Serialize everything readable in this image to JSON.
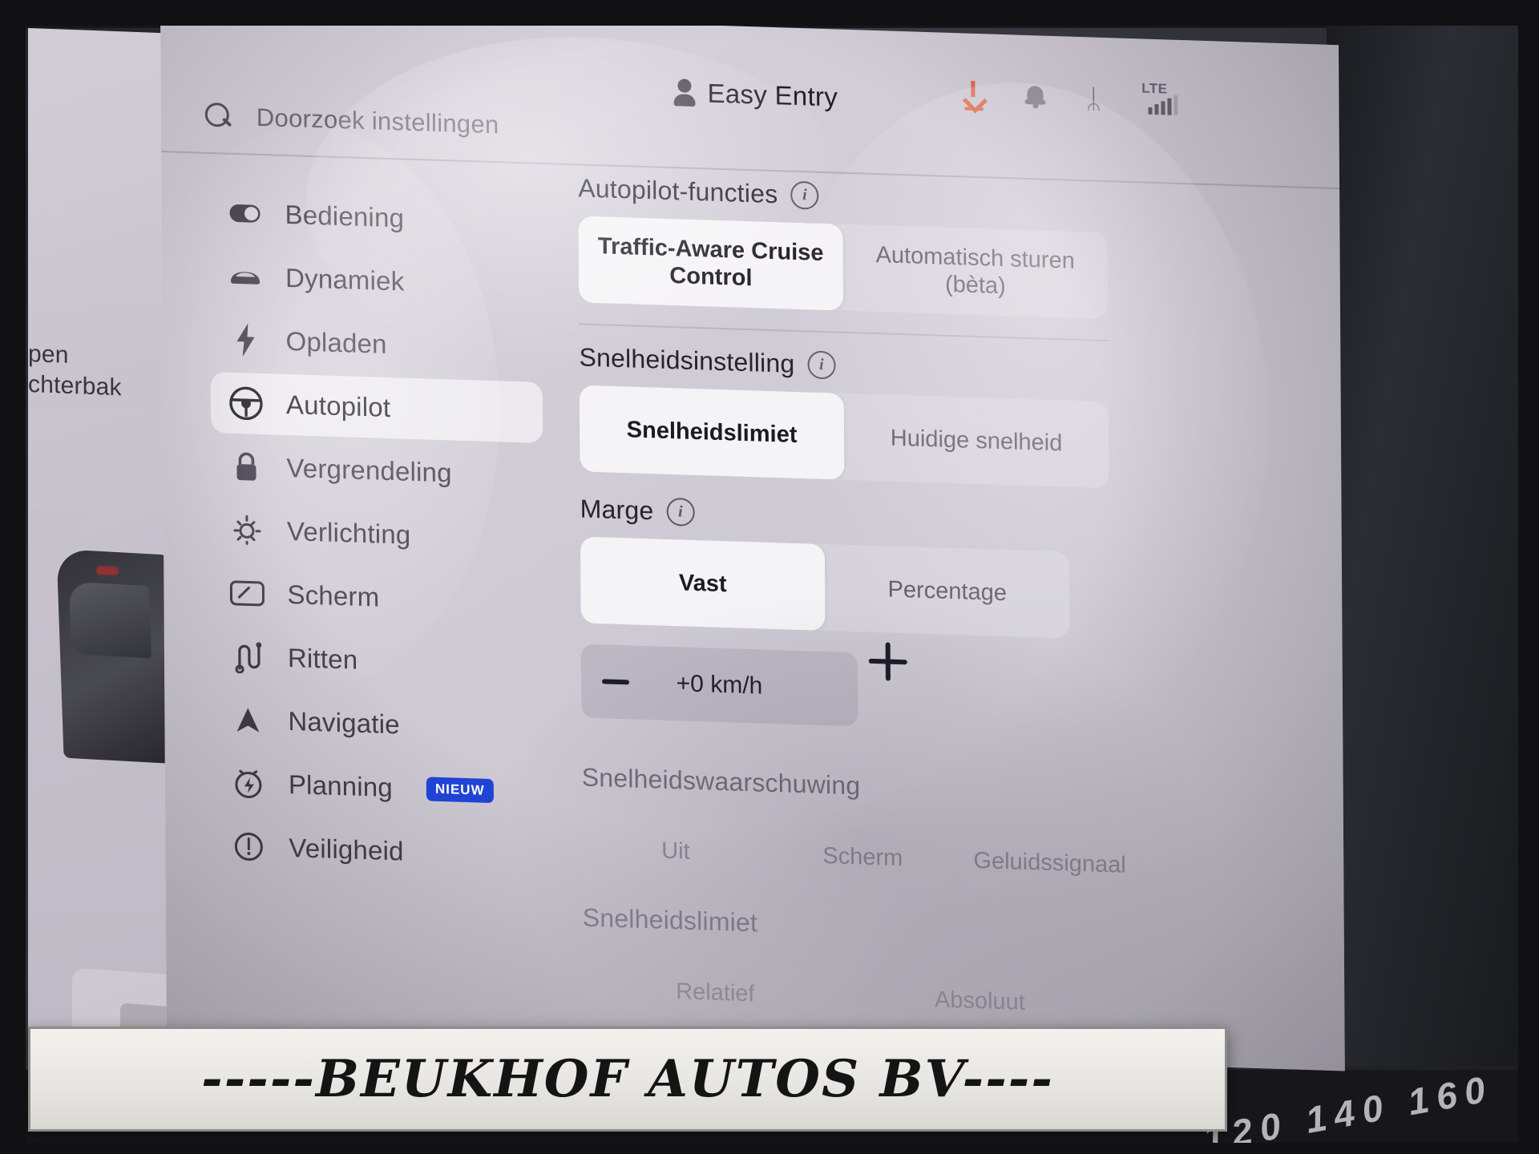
{
  "topbar": {
    "profile_name": "Easy Entry",
    "icons": [
      {
        "name": "download-icon",
        "label": "download"
      },
      {
        "name": "bell-icon",
        "label": "notifications"
      },
      {
        "name": "bluetooth-icon",
        "label": "bluetooth",
        "glyph": "ᛦ"
      },
      {
        "name": "lte-signal-icon",
        "label": "LTE"
      }
    ],
    "network_label": "LTE"
  },
  "search": {
    "placeholder": "Doorzoek instellingen",
    "value": ""
  },
  "sidebar": {
    "items": [
      {
        "label": "Bediening",
        "icon": "toggle-icon",
        "active": false
      },
      {
        "label": "Dynamiek",
        "icon": "car-icon",
        "active": false
      },
      {
        "label": "Opladen",
        "icon": "bolt-icon",
        "active": false
      },
      {
        "label": "Autopilot",
        "icon": "steering-wheel-icon",
        "active": true
      },
      {
        "label": "Vergrendeling",
        "icon": "lock-icon",
        "active": false
      },
      {
        "label": "Verlichting",
        "icon": "brightness-icon",
        "active": false
      },
      {
        "label": "Scherm",
        "icon": "display-icon",
        "active": false
      },
      {
        "label": "Ritten",
        "icon": "route-icon",
        "active": false
      },
      {
        "label": "Navigatie",
        "icon": "navigation-arrow-icon",
        "active": false
      },
      {
        "label": "Planning",
        "icon": "schedule-icon",
        "active": false,
        "badge": "NIEUW"
      },
      {
        "label": "Veiligheid",
        "icon": "alert-circle-icon",
        "active": false
      }
    ]
  },
  "content": {
    "sections": [
      {
        "title": "Autopilot-functies",
        "options": [
          "Traffic-Aware Cruise Control",
          "Automatisch sturen (bèta)"
        ],
        "selected": "Traffic-Aware Cruise Control"
      },
      {
        "title": "Snelheidsinstelling",
        "options": [
          "Snelheidslimiet",
          "Huidige snelheid"
        ],
        "selected": "Snelheidslimiet"
      },
      {
        "title": "Marge",
        "options": [
          "Vast",
          "Percentage"
        ],
        "selected": "Vast",
        "stepper": {
          "value": "+0 km/h",
          "decrease": "−",
          "increase": "+"
        }
      },
      {
        "title": "Snelheidswaarschuwing",
        "options": [
          "Uit",
          "Scherm",
          "Geluidssignaal"
        ],
        "selected": ""
      },
      {
        "title": "Snelheidslimiet",
        "options": [
          "Relatief",
          "Absoluut"
        ],
        "selected": ""
      }
    ]
  },
  "left_panel": {
    "line1": "pen",
    "line2": "chterbak"
  },
  "watermark": {
    "text": "-----BEUKHOF AUTOS BV----",
    "speedo": "120 140 160"
  },
  "colors": {
    "accent_download": "#e8522a",
    "badge_blue": "#1f44d8",
    "screen_bg": "#d4cfd9",
    "text_primary": "#211f28",
    "text_muted": "#6e6a78"
  }
}
